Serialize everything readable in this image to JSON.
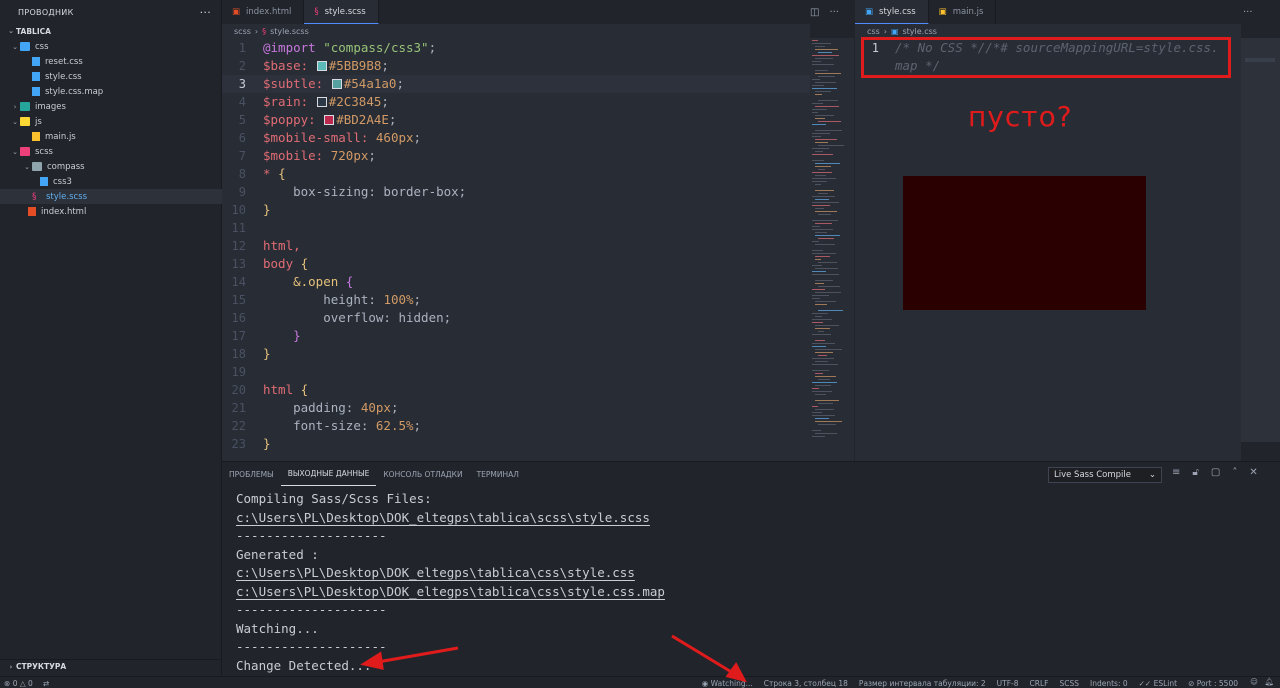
{
  "sidebar": {
    "title": "ПРОВОДНИК",
    "menu_icon": "ellipsis-icon",
    "root": "TABLICA",
    "items": [
      {
        "label": "css",
        "type": "folder",
        "open": true
      },
      {
        "label": "reset.css",
        "type": "css"
      },
      {
        "label": "style.css",
        "type": "css"
      },
      {
        "label": "style.css.map",
        "type": "css"
      },
      {
        "label": "images",
        "type": "folder",
        "open": false
      },
      {
        "label": "js",
        "type": "folder",
        "open": true
      },
      {
        "label": "main.js",
        "type": "js"
      },
      {
        "label": "scss",
        "type": "folder",
        "open": true
      },
      {
        "label": "compass",
        "type": "folder",
        "open": true
      },
      {
        "label": "css3",
        "type": "css"
      },
      {
        "label": "style.scss",
        "type": "scss"
      },
      {
        "label": "index.html",
        "type": "html"
      }
    ],
    "structure": "СТРУКТУРА"
  },
  "tabs_left": [
    {
      "label": "index.html",
      "icon": "html5-icon"
    },
    {
      "label": "style.scss",
      "icon": "sass-icon"
    }
  ],
  "tabs_right": [
    {
      "label": "style.css",
      "icon": "css3-icon"
    },
    {
      "label": "main.js",
      "icon": "js-icon"
    }
  ],
  "breadcrumb_left": [
    "scss",
    "style.scss"
  ],
  "breadcrumb_right": [
    "css",
    "style.css"
  ],
  "editor_left": {
    "current_line": 3,
    "line_numbers": [
      "1",
      "2",
      "3",
      "4",
      "5",
      "6",
      "7",
      "8",
      "9",
      "10",
      "11",
      "12",
      "13",
      "14",
      "15",
      "16",
      "17",
      "18",
      "19",
      "20",
      "21",
      "22",
      "23"
    ],
    "code": {
      "l1_kw": "@import",
      "l1_str": "\"compass/css3\"",
      "l1_end": ";",
      "l2_var": "$base:",
      "l2_val": "#5BB9B8",
      "l2_end": ";",
      "l3_var": "$subtle:",
      "l3_val": "#54a1a0",
      "l3_end": ";",
      "l4_var": "$rain:",
      "l4_val": "#2C3845",
      "l4_end": ";",
      "l5_var": "$poppy:",
      "l5_val": "#BD2A4E",
      "l5_end": ";",
      "l6_var": "$mobile-small:",
      "l6_val": "460px",
      "l6_end": ";",
      "l7_var": "$mobile:",
      "l7_val": "720px",
      "l7_end": ";",
      "l8_sel": "*",
      "l8_brace": "{",
      "l9_prop": "box-sizing: border-box;",
      "l10_brace": "}",
      "l12_sel": "html,",
      "l13_sel": "body",
      "l13_brace": "{",
      "l14_sel": "&.open",
      "l14_brace": "{",
      "l15_prop": "height: ",
      "l15_val": "100%",
      "l15_end": ";",
      "l16_prop": "overflow: hidden;",
      "l17_brace": "}",
      "l18_brace": "}",
      "l20_sel": "html",
      "l20_brace": "{",
      "l21_prop": "padding: ",
      "l21_val": "40px",
      "l21_end": ";",
      "l22_prop": "font-size: ",
      "l22_val": "62.5%",
      "l22_end": ";",
      "l23_brace": "}"
    },
    "swatch_colors": {
      "base": "#5BB9B8",
      "subtle": "#54a1a0",
      "rain": "#2C3845",
      "poppy": "#BD2A4E"
    }
  },
  "editor_right": {
    "line_number": "1",
    "line1": "/* No CSS *//*# sourceMappingURL=style.css.",
    "line1_wrap": "map */"
  },
  "annotation_text": "пусто?",
  "panel": {
    "tabs": [
      "ПРОБЛЕМЫ",
      "ВЫХОДНЫЕ ДАННЫЕ",
      "КОНСОЛЬ ОТЛАДКИ",
      "ТЕРМИНАЛ"
    ],
    "active_tab": 1,
    "output_channel": "Live Sass Compile",
    "output": [
      "Compiling Sass/Scss Files:",
      "c:\\Users\\PL\\Desktop\\DOK_eltegps\\tablica\\scss\\style.scss",
      "--------------------",
      "Generated :",
      "c:\\Users\\PL\\Desktop\\DOK_eltegps\\tablica\\css\\style.css",
      "c:\\Users\\PL\\Desktop\\DOK_eltegps\\tablica\\css\\style.css.map",
      "--------------------",
      "Watching...",
      "--------------------",
      "Change Detected..."
    ]
  },
  "status": {
    "errors": "0",
    "warnings": "0",
    "watching": "Watching...",
    "position": "Строка 3, столбец 18",
    "tab_size": "Размер интервала табуляции: 2",
    "encoding": "UTF-8",
    "eol": "CRLF",
    "language": "SCSS",
    "indents": "Indents: 0",
    "eslint": "ESLint",
    "port": "Port : 5500"
  },
  "accent_colors": {
    "annotation": "#e01b1b",
    "active_tab_border": "#528bff"
  }
}
